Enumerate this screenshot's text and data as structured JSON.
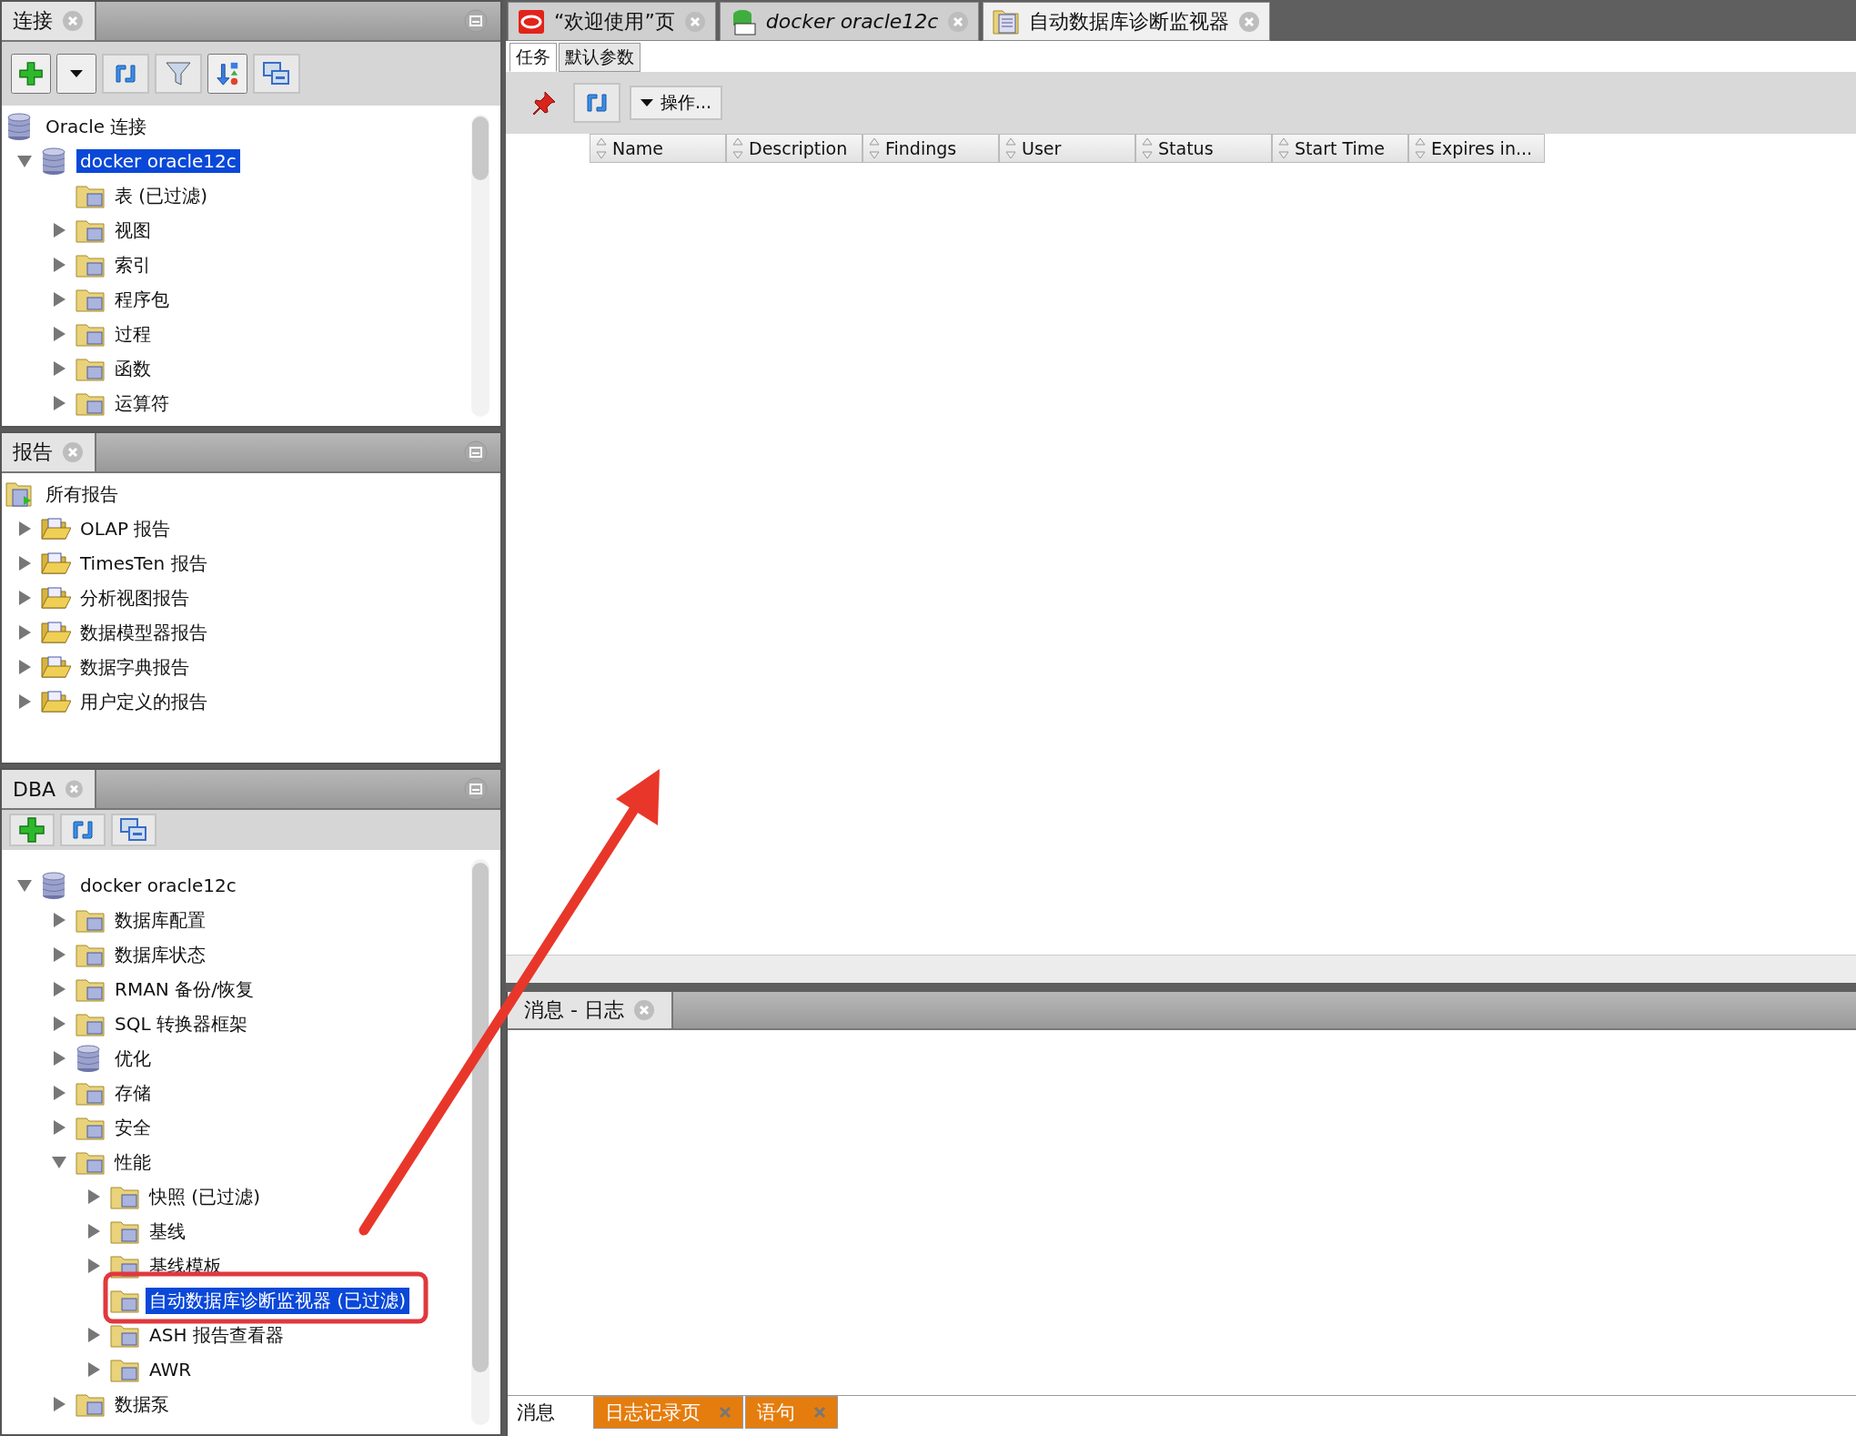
{
  "connections_panel": {
    "title": "连接",
    "tree": [
      {
        "label": "Oracle 连接",
        "kind": "database",
        "children": [
          {
            "label": "docker oracle12c",
            "kind": "database",
            "expanded": true,
            "selected": true,
            "children": [
              {
                "label": "表 (已过滤)",
                "kind": "folder"
              },
              {
                "label": "视图",
                "kind": "folder",
                "expanded": false
              },
              {
                "label": "索引",
                "kind": "folder",
                "expanded": false
              },
              {
                "label": "程序包",
                "kind": "folder",
                "expanded": false
              },
              {
                "label": "过程",
                "kind": "folder",
                "expanded": false
              },
              {
                "label": "函数",
                "kind": "folder",
                "expanded": false
              },
              {
                "label": "运算符",
                "kind": "folder",
                "expanded": false
              }
            ]
          }
        ]
      }
    ]
  },
  "reports_panel": {
    "title": "报告",
    "tree": [
      {
        "label": "所有报告",
        "kind": "report-root",
        "children": [
          {
            "label": "OLAP 报告",
            "kind": "open-folder",
            "expanded": false
          },
          {
            "label": "TimesTen 报告",
            "kind": "open-folder",
            "expanded": false
          },
          {
            "label": "分析视图报告",
            "kind": "open-folder",
            "expanded": false
          },
          {
            "label": "数据模型器报告",
            "kind": "open-folder",
            "expanded": false
          },
          {
            "label": "数据字典报告",
            "kind": "open-folder",
            "expanded": false
          },
          {
            "label": "用户定义的报告",
            "kind": "open-folder",
            "expanded": false
          }
        ]
      }
    ]
  },
  "dba_panel": {
    "title": "DBA",
    "tree": [
      {
        "label": "docker oracle12c",
        "kind": "database",
        "expanded": true,
        "children": [
          {
            "label": "数据库配置",
            "kind": "folder",
            "expanded": false
          },
          {
            "label": "数据库状态",
            "kind": "folder",
            "expanded": false
          },
          {
            "label": "RMAN 备份/恢复",
            "kind": "folder",
            "expanded": false
          },
          {
            "label": "SQL 转换器框架",
            "kind": "folder",
            "expanded": false
          },
          {
            "label": "优化",
            "kind": "database",
            "expanded": false
          },
          {
            "label": "存储",
            "kind": "folder",
            "expanded": false
          },
          {
            "label": "安全",
            "kind": "folder",
            "expanded": false
          },
          {
            "label": "性能",
            "kind": "folder",
            "expanded": true,
            "children": [
              {
                "label": "快照 (已过滤)",
                "kind": "folder",
                "expanded": false
              },
              {
                "label": "基线",
                "kind": "folder",
                "expanded": false
              },
              {
                "label": "基线模板",
                "kind": "folder",
                "expanded": false
              },
              {
                "label": "自动数据库诊断监视器 (已过滤)",
                "kind": "folder",
                "selected": true
              },
              {
                "label": "ASH 报告查看器",
                "kind": "folder",
                "expanded": false
              },
              {
                "label": "AWR",
                "kind": "folder",
                "expanded": false
              }
            ]
          },
          {
            "label": "数据泵",
            "kind": "folder",
            "expanded": false
          }
        ]
      }
    ]
  },
  "editor_tabs": [
    {
      "label": "“欢迎使用”页",
      "kind": "welcome",
      "selected": false
    },
    {
      "label": "docker oracle12c",
      "kind": "sql",
      "selected": false
    },
    {
      "label": "自动数据库诊断监视器",
      "kind": "monitor",
      "selected": true
    }
  ],
  "sub_tabs": [
    {
      "label": "任务",
      "selected": true
    },
    {
      "label": "默认参数",
      "selected": false
    }
  ],
  "actions_button": "操作...",
  "table": {
    "columns": [
      "Name",
      "Description",
      "Findings",
      "User",
      "Status",
      "Start Time",
      "Expires in..."
    ]
  },
  "log_panel": {
    "title": "消息 - 日志",
    "tabs": [
      {
        "label": "消息",
        "selected": true,
        "closable": false
      },
      {
        "label": "日志记录页",
        "selected": false,
        "closable": true
      },
      {
        "label": "语句",
        "selected": false,
        "closable": true
      }
    ]
  }
}
